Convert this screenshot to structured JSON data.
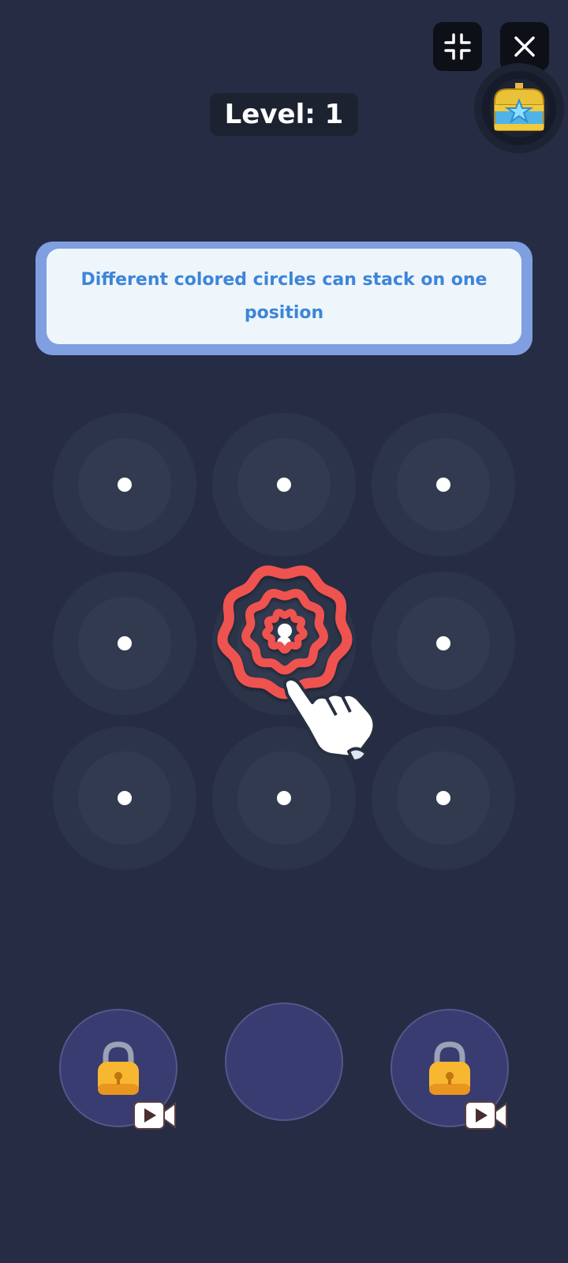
{
  "header": {
    "level_label": "Level: 1",
    "minimize_icon": "minimize-icon",
    "close_icon": "close-icon",
    "chest_icon": "treasure-chest-icon"
  },
  "hint": {
    "text": "Different colored circles can stack on one position"
  },
  "board": {
    "rows": 3,
    "cols": 3,
    "stack_position": [
      1,
      1
    ],
    "stack_color": "#ef5350",
    "ring_sizes": [
      "large",
      "medium",
      "small"
    ]
  },
  "trays": [
    {
      "state": "locked",
      "icon": "padlock-icon",
      "unlock_icon": "video-icon"
    },
    {
      "state": "empty"
    },
    {
      "state": "locked",
      "icon": "padlock-icon",
      "unlock_icon": "video-icon"
    }
  ],
  "tutorial": {
    "pointer_icon": "pointing-hand-icon"
  },
  "colors": {
    "background": "#262c44",
    "hint_text": "#3d85d8",
    "tray": "#393c71",
    "lock": "#f7b731"
  }
}
